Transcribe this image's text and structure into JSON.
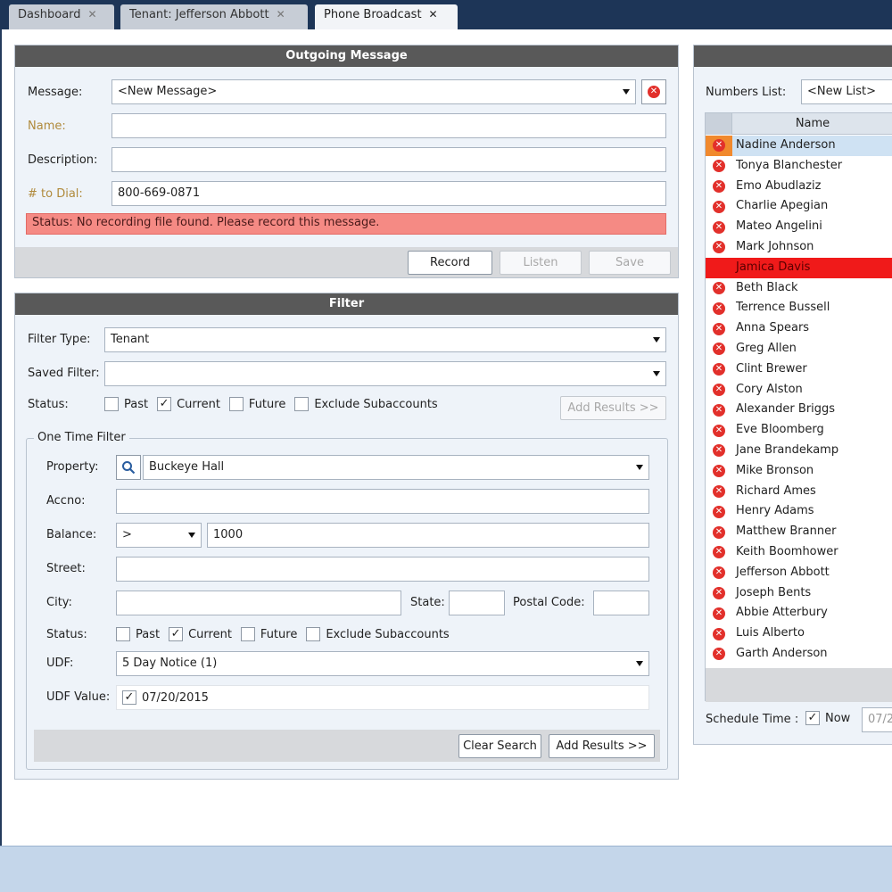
{
  "tabs": [
    {
      "label": "Dashboard",
      "close": "✕"
    },
    {
      "label": "Tenant: Jefferson Abbott",
      "close": "✕"
    },
    {
      "label": "Phone Broadcast",
      "close": "✕"
    }
  ],
  "outgoing": {
    "header": "Outgoing Message",
    "message_label": "Message:",
    "message_value": "<New Message>",
    "name_label": "Name:",
    "name_value": "",
    "description_label": "Description:",
    "description_value": "",
    "dial_label": "# to Dial:",
    "dial_value": "800-669-0871",
    "status_text": "Status: No recording file found. Please record this message.",
    "record_label": "Record",
    "listen_label": "Listen",
    "save_label": "Save"
  },
  "filter": {
    "header": "Filter",
    "filter_type_label": "Filter Type:",
    "filter_type_value": "Tenant",
    "saved_filter_label": "Saved Filter:",
    "saved_filter_value": "",
    "status_label": "Status:",
    "past_label": "Past",
    "current_label": "Current",
    "future_label": "Future",
    "exclude_label": "Exclude Subaccounts",
    "add_results_label": "Add Results >>"
  },
  "one_time": {
    "legend": "One Time Filter",
    "property_label": "Property:",
    "property_value": "Buckeye Hall",
    "accno_label": "Accno:",
    "accno_value": "",
    "balance_label": "Balance:",
    "balance_op": ">",
    "balance_value": "1000",
    "street_label": "Street:",
    "street_value": "",
    "city_label": "City:",
    "city_value": "",
    "state_label": "State:",
    "state_value": "",
    "postal_label": "Postal Code:",
    "postal_value": "",
    "status_label": "Status:",
    "past_label": "Past",
    "current_label": "Current",
    "future_label": "Future",
    "exclude_label": "Exclude Subaccounts",
    "udf_label": "UDF:",
    "udf_value": "5 Day Notice (1)",
    "udf_value_label": "UDF Value:",
    "udf_value_date": "07/20/2015",
    "clear_label": "Clear Search",
    "add_results_label": "Add Results >>"
  },
  "numbers": {
    "label": "Numbers List:",
    "value": "<New List>",
    "column_name": "Name",
    "rows": [
      "Nadine Anderson",
      "Tonya Blanchester",
      "Emo Abudlaziz",
      "Charlie Apegian",
      "Mateo Angelini",
      "Mark Johnson",
      "Jamica Davis",
      "Beth Black",
      "Terrence Bussell",
      "Anna Spears",
      "Greg Allen",
      "Clint Brewer",
      "Cory Alston",
      "Alexander Briggs",
      "Eve Bloomberg",
      "Jane Brandekamp",
      "Mike Bronson",
      "Richard Ames",
      "Henry Adams",
      "Matthew Branner",
      "Keith Boomhower",
      "Jefferson Abbott",
      "Joseph Bents",
      "Abbie Atterbury",
      "Luis Alberto",
      "Garth Anderson"
    ],
    "schedule_label": "Schedule Time :",
    "now_label": "Now",
    "date_partial": "07/2"
  },
  "colors": {
    "tabbar": "#1d3557",
    "status_error": "#f58a84",
    "row_error": "#f01a1a",
    "row_selected": "#cfe2f3",
    "accent_orange": "#f1892d"
  }
}
